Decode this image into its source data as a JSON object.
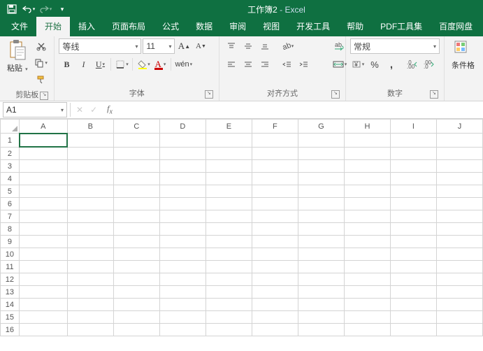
{
  "title": {
    "doc": "工作簿2",
    "app": "Excel",
    "sep": " - "
  },
  "tabs": {
    "file": "文件",
    "home": "开始",
    "insert": "插入",
    "layout": "页面布局",
    "formulas": "公式",
    "data": "数据",
    "review": "审阅",
    "view": "视图",
    "dev": "开发工具",
    "help": "帮助",
    "pdf": "PDF工具集",
    "baidu": "百度网盘"
  },
  "clipboard": {
    "paste": "粘贴",
    "group": "剪贴板"
  },
  "font": {
    "name": "等线",
    "size": "11",
    "group": "字体",
    "bold": "B",
    "italic": "I",
    "underline": "U",
    "increase": "A",
    "decrease": "A",
    "phonetic": "wén"
  },
  "align": {
    "group": "对齐方式",
    "wrap": "ab",
    "merge": "⬌"
  },
  "number": {
    "group": "数字",
    "format": "常规",
    "percent": "%",
    "comma": ",",
    "inc": ".0",
    "dec": ".0"
  },
  "cond": {
    "label": "条件格"
  },
  "namebox": "A1",
  "columns": [
    "A",
    "B",
    "C",
    "D",
    "E",
    "F",
    "G",
    "H",
    "I",
    "J"
  ],
  "rows": [
    "1",
    "2",
    "3",
    "4",
    "5",
    "6",
    "7",
    "8",
    "9",
    "10",
    "11",
    "12",
    "13",
    "14",
    "15",
    "16"
  ]
}
